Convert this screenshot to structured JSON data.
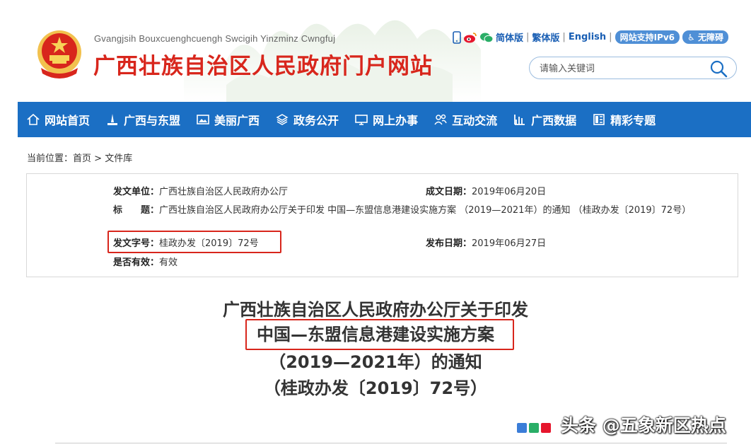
{
  "header": {
    "subtitle": "Gvangjsih Bouxcuenghcuengh Swcigih Yinzminz Cwngfuj",
    "title": "广西壮族自治区人民政府门户网站",
    "links": [
      "简体版",
      "繁体版",
      "English"
    ],
    "ipv6_badge": "网站支持IPv6",
    "accessible_badge": "无障碍",
    "search_placeholder": "请输入关键词"
  },
  "nav": {
    "items": [
      {
        "label": "网站首页",
        "icon": "home-icon"
      },
      {
        "label": "广西与东盟",
        "icon": "monument-icon"
      },
      {
        "label": "美丽广西",
        "icon": "picture-icon"
      },
      {
        "label": "政务公开",
        "icon": "layers-icon"
      },
      {
        "label": "网上办事",
        "icon": "monitor-icon"
      },
      {
        "label": "互动交流",
        "icon": "users-icon"
      },
      {
        "label": "广西数据",
        "icon": "bar-chart-icon"
      },
      {
        "label": "精彩专题",
        "icon": "topic-icon"
      }
    ]
  },
  "breadcrumb": {
    "prefix": "当前位置：",
    "home": "首页",
    "sep": " > ",
    "current": "文件库"
  },
  "meta": {
    "issuer_label": "发文单位：",
    "issuer": "广西壮族自治区人民政府办公厅",
    "date_made_label": "成文日期：",
    "date_made": "2019年06月20日",
    "title_label": "标　　题：",
    "title_value": "广西壮族自治区人民政府办公厅关于印发 中国—东盟信息港建设实施方案 （2019—2021年）的通知 （桂政办发〔2019〕72号）",
    "doc_no_label": "发文字号：",
    "doc_no": "桂政办发〔2019〕72号",
    "pub_date_label": "发布日期：",
    "pub_date": "2019年06月27日",
    "valid_label": "是否有效：",
    "valid": "有效"
  },
  "document": {
    "line1": "广西壮族自治区人民政府办公厅关于印发",
    "line2": "中国—东盟信息港建设实施方案",
    "line3": "（2019—2021年）的通知",
    "line4": "（桂政办发〔2019〕72号）"
  },
  "watermark": "头条 @五象新区热点",
  "colors": {
    "brand_red": "#d8261c",
    "nav_blue": "#1b6fc4",
    "link_blue": "#1a5fb4",
    "badge_blue": "#4f8fd6"
  }
}
